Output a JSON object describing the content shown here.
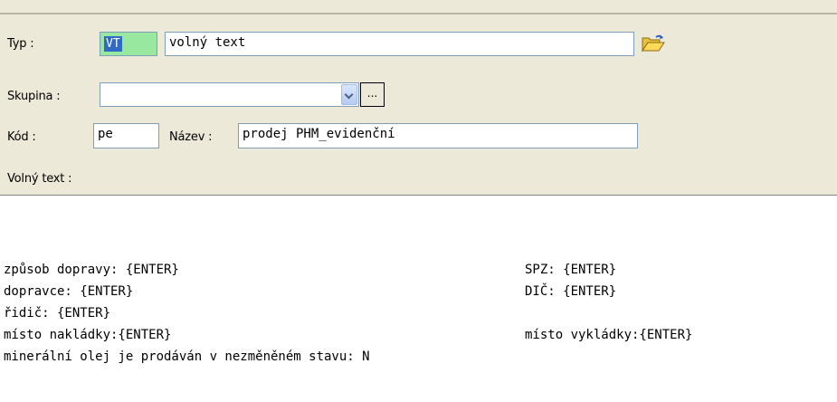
{
  "form": {
    "typ_label": "Typ :",
    "typ_code": "VT",
    "typ_name": "volný text",
    "skupina_label": "Skupina :",
    "skupina_value": "",
    "skupina_more": "...",
    "kod_label": "Kód :",
    "kod_value": "pe",
    "nazev_label": "Název :",
    "nazev_value": "prodej PHM_evidenční",
    "volny_text_label": "Volný text :"
  },
  "text_content": {
    "line1_left": "způsob dopravy: {ENTER}",
    "line1_right": "SPZ: {ENTER}",
    "line2_left": "dopravce: {ENTER}",
    "line2_right": "DIČ: {ENTER}",
    "line3": "řidič: {ENTER}",
    "line4_left": "místo nakládky:{ENTER}",
    "line4_right": "místo vykládky:{ENTER}",
    "line5": "minerální olej je prodáván v nezměněném stavu: N"
  },
  "icons": {
    "open_folder": "open-folder-icon",
    "dropdown": "chevron-down-icon"
  },
  "colors": {
    "panel_bg": "#ece9d8",
    "field_border": "#7f9db9",
    "code_bg": "#98e8a0",
    "selection_bg": "#3169c6"
  }
}
